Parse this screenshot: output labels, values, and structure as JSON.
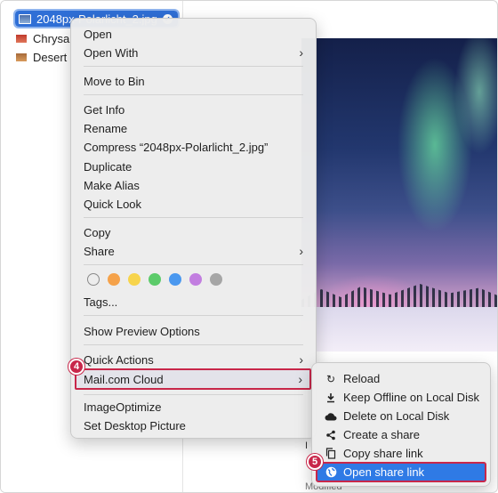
{
  "files": [
    {
      "name": "2048px-Polarlicht_2.jpg",
      "selected": true,
      "synced": true
    },
    {
      "name": "Chrysa",
      "selected": false
    },
    {
      "name": "Desert",
      "selected": false
    }
  ],
  "preview": {
    "info_label": "I",
    "modified_label": "Modified"
  },
  "context_menu": {
    "open": "Open",
    "open_with": "Open With",
    "move_to_bin": "Move to Bin",
    "get_info": "Get Info",
    "rename": "Rename",
    "compress": "Compress “2048px-Polarlicht_2.jpg”",
    "duplicate": "Duplicate",
    "make_alias": "Make Alias",
    "quick_look": "Quick Look",
    "copy": "Copy",
    "share": "Share",
    "tags": "Tags...",
    "show_preview_options": "Show Preview Options",
    "quick_actions": "Quick Actions",
    "mailcom_cloud": "Mail.com Cloud",
    "image_optimize": "ImageOptimize",
    "set_desktop_picture": "Set Desktop Picture",
    "tag_colors": [
      "none",
      "#f5a24a",
      "#f7d44c",
      "#5ccb6a",
      "#4a98ef",
      "#c27ee0",
      "#a6a6a6"
    ]
  },
  "submenu": {
    "reload": "Reload",
    "keep_offline": "Keep Offline on Local Disk",
    "delete_local": "Delete on Local Disk",
    "create_share": "Create a share",
    "copy_share_link": "Copy share link",
    "open_share_link": "Open share link"
  },
  "steps": {
    "step4": "4",
    "step5": "5"
  },
  "colors": {
    "accent": "#2f7ae5",
    "highlight_border": "#c8274a"
  }
}
